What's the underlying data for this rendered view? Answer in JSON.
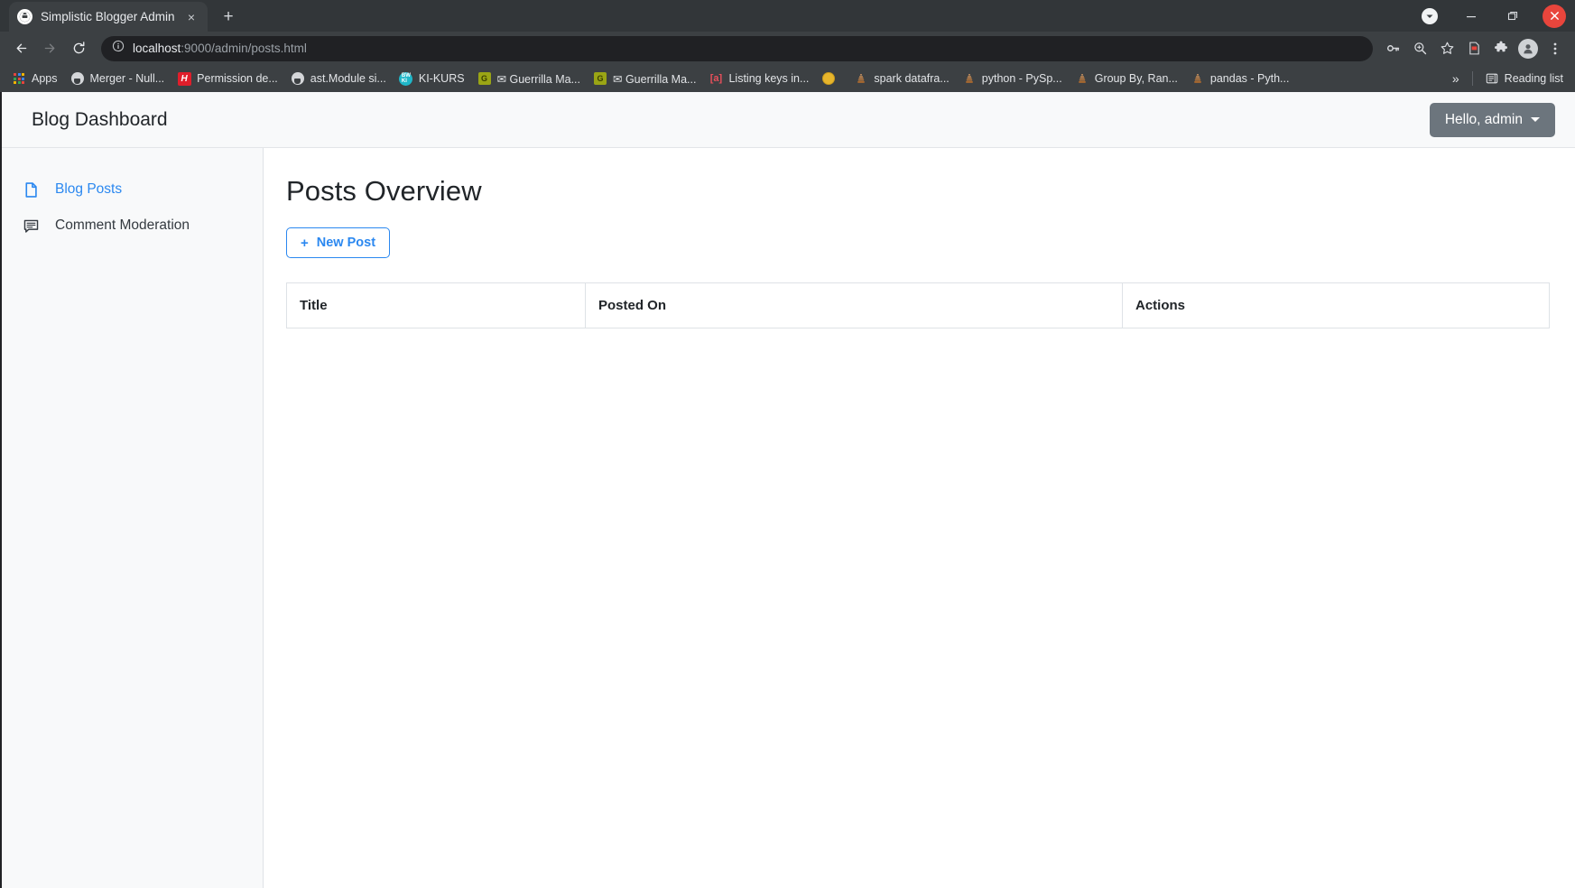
{
  "browser": {
    "tab": {
      "title": "Simplistic Blogger Admin",
      "favicon": "globe-icon",
      "close_label": "×"
    },
    "new_tab_label": "+",
    "window_controls": {
      "update_label": "▾",
      "minimize_label": "—",
      "maximize_label": "❐",
      "close_label": "✕"
    },
    "nav": {
      "back_label": "←",
      "forward_label": "→",
      "reload_label": "↻"
    },
    "omnibox": {
      "info_icon": "site-info-icon",
      "host": "localhost",
      "path": ":9000/admin/posts.html",
      "full_url": "localhost:9000/admin/posts.html"
    },
    "toolbar_icons": [
      "password-key-icon",
      "zoom-magnifier-icon",
      "bookmark-star-icon",
      "reading-mode-icon",
      "extensions-puzzle-icon",
      "profile-avatar-icon",
      "three-dot-menu-icon"
    ],
    "bookmarks": [
      {
        "label": "Apps",
        "icon": "apps-grid-icon"
      },
      {
        "label": "Merger - Null...",
        "icon": "github-icon"
      },
      {
        "label": "Permission de...",
        "icon": "h-red-icon"
      },
      {
        "label": "ast.Module si...",
        "icon": "github-icon"
      },
      {
        "label": "KI-KURS",
        "icon": "ki-kurs-icon"
      },
      {
        "label": "✉ Guerrilla Ma...",
        "icon": "guerrilla-g-icon"
      },
      {
        "label": "✉ Guerrilla Ma...",
        "icon": "guerrilla-g-icon"
      },
      {
        "label": "Listing keys in...",
        "icon": "atlassian-a-icon"
      },
      {
        "label": "",
        "icon": "yellow-circle-icon"
      },
      {
        "label": "spark datafra...",
        "icon": "stackoverflow-icon"
      },
      {
        "label": "python - PySp...",
        "icon": "stackoverflow-icon"
      },
      {
        "label": "Group By, Ran...",
        "icon": "stackoverflow-icon"
      },
      {
        "label": "pandas - Pyth...",
        "icon": "stackoverflow-icon"
      }
    ],
    "bookmarks_overflow_label": "»",
    "reading_list": {
      "label": "Reading list",
      "icon": "reading-list-icon"
    }
  },
  "app": {
    "header": {
      "title": "Blog Dashboard",
      "user_menu_label": "Hello, admin"
    },
    "sidebar": {
      "items": [
        {
          "label": "Blog Posts",
          "icon": "file-document-icon",
          "active": true
        },
        {
          "label": "Comment Moderation",
          "icon": "comment-bubble-icon",
          "active": false
        }
      ]
    },
    "main": {
      "page_title": "Posts Overview",
      "new_post_button": {
        "plus": "+",
        "label": "New Post"
      },
      "table": {
        "columns": [
          "Title",
          "Posted On",
          "Actions"
        ],
        "rows": []
      }
    },
    "colors": {
      "accent_blue": "#2b88f0",
      "user_menu_gray": "#6c757d",
      "panel_bg": "#f8f9fa",
      "border": "#dee2e6"
    }
  }
}
